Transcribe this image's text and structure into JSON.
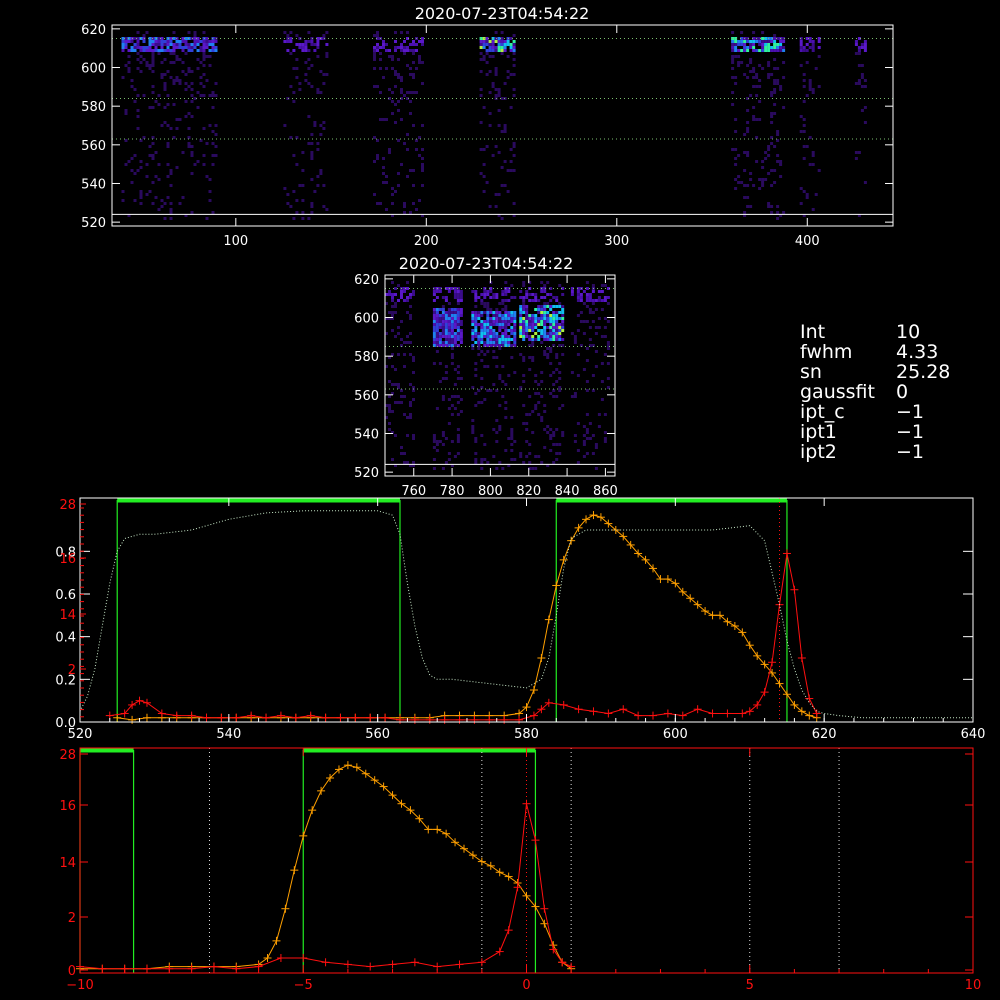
{
  "title": "2020-07-23T04:54:22",
  "info": [
    {
      "key": "Int",
      "value": "10"
    },
    {
      "key": "fwhm",
      "value": "4.33"
    },
    {
      "key": "sn",
      "value": "25.28"
    },
    {
      "key": "gaussfit",
      "value": "0"
    },
    {
      "key": "ipt_c",
      "value": "−1"
    },
    {
      "key": "ipt1",
      "value": "−1"
    },
    {
      "key": "ipt2",
      "value": "−1"
    }
  ],
  "colors": {
    "axis": "#ffffff",
    "orange": "#ffa000",
    "red": "#ff1010",
    "green": "#22ee22",
    "dotted": "#c8e8c8"
  },
  "chart_data": [
    {
      "type": "heatmap",
      "title": "2020-07-23T04:54:22",
      "xlim": [
        35,
        445
      ],
      "ylim": [
        518,
        622
      ],
      "xticks": [
        "100",
        "200",
        "300",
        "400"
      ],
      "yticks": [
        "520",
        "540",
        "560",
        "580",
        "600",
        "620"
      ],
      "bands_x": [
        [
          40,
          90
        ],
        [
          125,
          148
        ],
        [
          172,
          198
        ],
        [
          228,
          246
        ],
        [
          360,
          388
        ],
        [
          396,
          406
        ],
        [
          425,
          430
        ]
      ],
      "hlines_y": [
        524,
        584,
        563,
        615
      ]
    },
    {
      "type": "heatmap",
      "title": "2020-07-23T04:54:22",
      "xlim": [
        745,
        865
      ],
      "ylim": [
        518,
        622
      ],
      "xticks": [
        "760",
        "780",
        "800",
        "820",
        "840",
        "860"
      ],
      "yticks": [
        "520",
        "540",
        "560",
        "580",
        "600",
        "620"
      ],
      "hlines_y": [
        524,
        563,
        585,
        615
      ]
    },
    {
      "type": "line",
      "xlim": [
        520,
        640
      ],
      "ylim": [
        0,
        1.05
      ],
      "xticks": [
        "520",
        "540",
        "560",
        "580",
        "600",
        "620",
        "640"
      ],
      "yticks_left": [
        "0.0",
        "0.2",
        "0.4",
        "0.6",
        "0.8"
      ],
      "yticks_right_labels": [
        "2",
        "14",
        "16",
        "28"
      ],
      "green_regions": [
        [
          525,
          563
        ],
        [
          584,
          615
        ]
      ],
      "red_dotted_x": [
        614
      ],
      "series": [
        {
          "color": "orange",
          "x": [
            525,
            527,
            529,
            531,
            533,
            535,
            537,
            539,
            541,
            543,
            545,
            547,
            549,
            551,
            553,
            555,
            557,
            559,
            561,
            563,
            565,
            567,
            569,
            571,
            573,
            575,
            577,
            579,
            580,
            581,
            582,
            583,
            584,
            585,
            586,
            587,
            588,
            589,
            590,
            591,
            592,
            593,
            594,
            595,
            596,
            597,
            598,
            599,
            600,
            601,
            602,
            603,
            604,
            605,
            606,
            607,
            608,
            609,
            610,
            611,
            612,
            613,
            614,
            615,
            616,
            617,
            618,
            619
          ],
          "y": [
            0.02,
            0.01,
            0.02,
            0.02,
            0.02,
            0.02,
            0.02,
            0.02,
            0.02,
            0.02,
            0.02,
            0.02,
            0.02,
            0.02,
            0.02,
            0.02,
            0.02,
            0.02,
            0.02,
            0.02,
            0.02,
            0.02,
            0.03,
            0.03,
            0.03,
            0.03,
            0.03,
            0.04,
            0.07,
            0.15,
            0.3,
            0.48,
            0.64,
            0.76,
            0.85,
            0.91,
            0.95,
            0.97,
            0.96,
            0.93,
            0.9,
            0.87,
            0.83,
            0.79,
            0.76,
            0.72,
            0.67,
            0.67,
            0.65,
            0.61,
            0.58,
            0.55,
            0.52,
            0.5,
            0.5,
            0.47,
            0.45,
            0.42,
            0.36,
            0.31,
            0.27,
            0.23,
            0.18,
            0.13,
            0.08,
            0.05,
            0.03,
            0.02
          ]
        },
        {
          "color": "red",
          "x": [
            524,
            526,
            527,
            528,
            529,
            531,
            533,
            535,
            537,
            539,
            541,
            543,
            545,
            547,
            549,
            551,
            553,
            555,
            557,
            559,
            561,
            563,
            565,
            567,
            569,
            571,
            573,
            575,
            577,
            579,
            581,
            582,
            583,
            585,
            587,
            589,
            591,
            593,
            595,
            597,
            599,
            601,
            603,
            605,
            607,
            609,
            610,
            611,
            612,
            613,
            614,
            615,
            616,
            617,
            618,
            619
          ],
          "y": [
            0.03,
            0.04,
            0.08,
            0.1,
            0.09,
            0.04,
            0.03,
            0.03,
            0.02,
            0.02,
            0.02,
            0.03,
            0.02,
            0.03,
            0.02,
            0.03,
            0.02,
            0.02,
            0.02,
            0.02,
            0.02,
            0.01,
            0.01,
            0.01,
            0.01,
            0.01,
            0.01,
            0.01,
            0.01,
            0.01,
            0.03,
            0.06,
            0.09,
            0.08,
            0.06,
            0.05,
            0.04,
            0.06,
            0.03,
            0.03,
            0.04,
            0.03,
            0.06,
            0.04,
            0.04,
            0.04,
            0.05,
            0.08,
            0.14,
            0.28,
            0.55,
            0.79,
            0.62,
            0.3,
            0.11,
            0.04
          ]
        },
        {
          "color": "dotted",
          "x": [
            520,
            521,
            522,
            523,
            524,
            525,
            526,
            528,
            530,
            535,
            540,
            545,
            550,
            555,
            560,
            562,
            563,
            564,
            565,
            566,
            567,
            568,
            570,
            575,
            580,
            582,
            583,
            584,
            585,
            586,
            588,
            590,
            595,
            600,
            605,
            610,
            612,
            613,
            614,
            615,
            616,
            617,
            618,
            619,
            620,
            622,
            625,
            630,
            640
          ],
          "y": [
            0.05,
            0.12,
            0.25,
            0.45,
            0.65,
            0.8,
            0.86,
            0.88,
            0.88,
            0.9,
            0.95,
            0.98,
            0.99,
            0.99,
            0.99,
            0.97,
            0.88,
            0.65,
            0.45,
            0.3,
            0.22,
            0.2,
            0.2,
            0.18,
            0.16,
            0.2,
            0.3,
            0.5,
            0.72,
            0.86,
            0.9,
            0.9,
            0.9,
            0.9,
            0.9,
            0.92,
            0.85,
            0.7,
            0.55,
            0.38,
            0.25,
            0.15,
            0.09,
            0.05,
            0.04,
            0.03,
            0.02,
            0.02,
            0.02
          ]
        }
      ]
    },
    {
      "type": "line",
      "xlim": [
        -10,
        10
      ],
      "ylim": [
        0,
        1.05
      ],
      "xticks": [
        "−10",
        "−5",
        "0",
        "5",
        "10"
      ],
      "yticks_left_labels": [
        "0",
        "2",
        "14",
        "16",
        "28"
      ],
      "green_regions": [
        [
          -10,
          -8.8
        ],
        [
          -5,
          0.2
        ]
      ],
      "white_dotted_x": [
        -7.1,
        -1,
        1,
        5,
        7
      ],
      "red_dotted_x": [
        0
      ],
      "series": [
        {
          "color": "orange",
          "x": [
            -10,
            -9.5,
            -9,
            -8.5,
            -8,
            -7.5,
            -7,
            -6.5,
            -6,
            -5.8,
            -5.6,
            -5.4,
            -5.2,
            -5.0,
            -4.8,
            -4.6,
            -4.4,
            -4.2,
            -4.0,
            -3.8,
            -3.6,
            -3.4,
            -3.2,
            -3.0,
            -2.8,
            -2.6,
            -2.4,
            -2.2,
            -2.0,
            -1.8,
            -1.6,
            -1.4,
            -1.2,
            -1.0,
            -0.8,
            -0.6,
            -0.4,
            -0.2,
            0.0,
            0.2,
            0.4,
            0.6,
            0.8,
            1.0
          ],
          "y": [
            0.02,
            0.02,
            0.02,
            0.02,
            0.03,
            0.03,
            0.03,
            0.03,
            0.04,
            0.07,
            0.15,
            0.3,
            0.48,
            0.64,
            0.76,
            0.85,
            0.91,
            0.95,
            0.97,
            0.96,
            0.93,
            0.9,
            0.87,
            0.83,
            0.79,
            0.76,
            0.72,
            0.67,
            0.67,
            0.65,
            0.61,
            0.58,
            0.55,
            0.52,
            0.5,
            0.47,
            0.45,
            0.42,
            0.36,
            0.31,
            0.23,
            0.13,
            0.05,
            0.02
          ]
        },
        {
          "color": "red",
          "x": [
            -10,
            -9.5,
            -9,
            -8.5,
            -8,
            -7.5,
            -7,
            -6.5,
            -6,
            -5.5,
            -5.0,
            -4.5,
            -4.0,
            -3.5,
            -3.0,
            -2.5,
            -2.0,
            -1.5,
            -1.0,
            -0.6,
            -0.4,
            -0.2,
            0.0,
            0.2,
            0.4,
            0.6,
            0.8,
            1.0
          ],
          "y": [
            0.03,
            0.02,
            0.02,
            0.02,
            0.02,
            0.02,
            0.03,
            0.02,
            0.03,
            0.07,
            0.07,
            0.05,
            0.04,
            0.03,
            0.04,
            0.05,
            0.03,
            0.04,
            0.05,
            0.1,
            0.2,
            0.4,
            0.79,
            0.62,
            0.3,
            0.11,
            0.05,
            0.03
          ]
        }
      ]
    }
  ]
}
